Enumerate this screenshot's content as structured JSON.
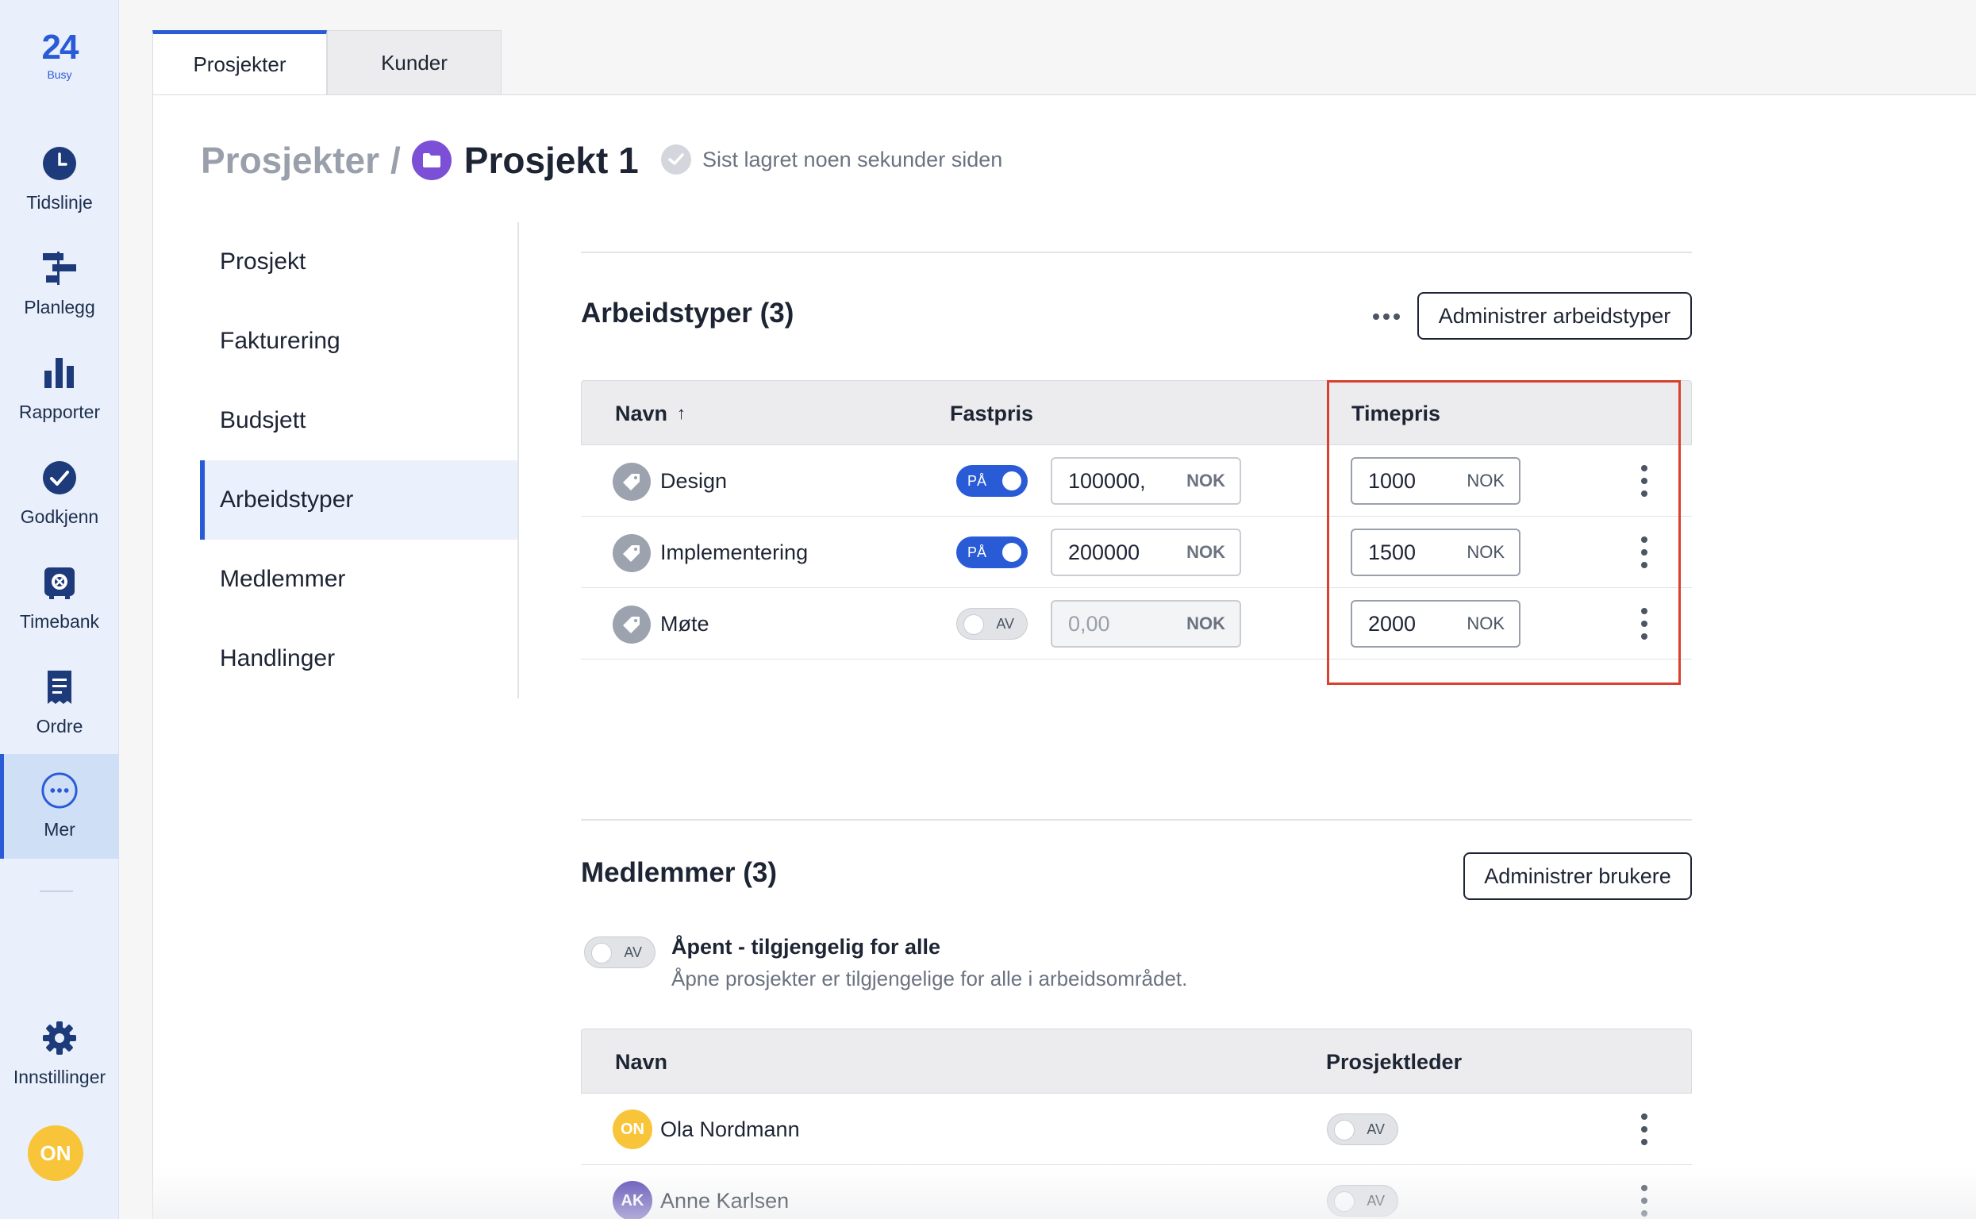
{
  "sidebar": {
    "logo": {
      "number": "24",
      "sub": "Busy"
    },
    "items": [
      {
        "label": "Tidslinje",
        "icon": "clock-icon"
      },
      {
        "label": "Planlegg",
        "icon": "gantt-icon"
      },
      {
        "label": "Rapporter",
        "icon": "bar-chart-icon"
      },
      {
        "label": "Godkjenn",
        "icon": "check-circle-icon"
      },
      {
        "label": "Timebank",
        "icon": "vault-icon"
      },
      {
        "label": "Ordre",
        "icon": "receipt-icon"
      },
      {
        "label": "Mer",
        "icon": "more-circle-icon"
      }
    ],
    "settings_label": "Innstillinger",
    "user_initials": "ON"
  },
  "tabs": [
    {
      "label": "Prosjekter"
    },
    {
      "label": "Kunder"
    }
  ],
  "breadcrumb": {
    "root": "Prosjekter",
    "separator": "/",
    "project": "Prosjekt 1",
    "saved_status": "Sist lagret noen sekunder siden"
  },
  "subnav": [
    {
      "label": "Prosjekt"
    },
    {
      "label": "Fakturering"
    },
    {
      "label": "Budsjett"
    },
    {
      "label": "Arbeidstyper"
    },
    {
      "label": "Medlemmer"
    },
    {
      "label": "Handlinger"
    }
  ],
  "worktypes": {
    "title": "Arbeidstyper (3)",
    "manage_button": "Administrer arbeidstyper",
    "columns": {
      "name": "Navn",
      "name_sort": "↑",
      "fixed": "Fastpris",
      "hourly": "Timepris"
    },
    "rows": [
      {
        "name": "Design",
        "fixed_toggle": "PÅ",
        "fixed_value": "100000,",
        "fixed_currency": "NOK",
        "hourly_value": "1000",
        "hourly_currency": "NOK"
      },
      {
        "name": "Implementering",
        "fixed_toggle": "PÅ",
        "fixed_value": "200000",
        "fixed_currency": "NOK",
        "hourly_value": "1500",
        "hourly_currency": "NOK"
      },
      {
        "name": "Møte",
        "fixed_toggle": "AV",
        "fixed_value": "0,00",
        "fixed_currency": "NOK",
        "hourly_value": "2000",
        "hourly_currency": "NOK"
      }
    ],
    "highlight_color": "#d9412e"
  },
  "members": {
    "title": "Medlemmer (3)",
    "manage_button": "Administrer brukere",
    "open_toggle": "AV",
    "open_title": "Åpent - tilgjengelig for alle",
    "open_desc": "Åpne prosjekter er tilgjengelige for alle i arbeidsområdet.",
    "columns": {
      "name": "Navn",
      "lead": "Prosjektleder"
    },
    "rows": [
      {
        "initials": "ON",
        "name": "Ola Nordmann",
        "lead_toggle": "AV",
        "color": "#f8c53a"
      },
      {
        "initials": "AK",
        "name": "Anne Karlsen",
        "lead_toggle": "AV",
        "color": "#5b4bb7"
      }
    ]
  },
  "colors": {
    "accent": "#2a5bd7",
    "project_icon": "#7b4fd6"
  }
}
